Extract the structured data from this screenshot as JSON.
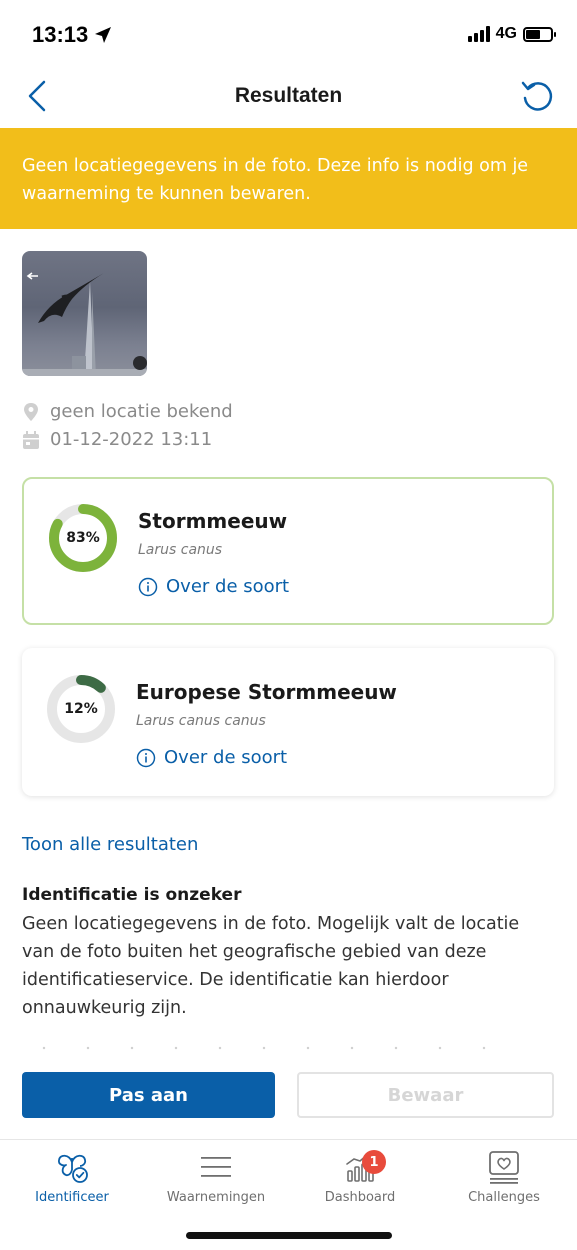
{
  "status": {
    "time": "13:13",
    "network": "4G"
  },
  "nav": {
    "title": "Resultaten"
  },
  "warning": {
    "text": "Geen locatiegegevens in de foto. Deze info is nodig om je waarneming te kunnen bewaren."
  },
  "meta": {
    "location": "geen locatie bekend",
    "date": "01-12-2022 13:11"
  },
  "results": [
    {
      "name": "Stormmeeuw",
      "scientific": "Larus canus",
      "percent_label": "83%",
      "percent": 83,
      "link": "Over de soort",
      "color": "#7db33b"
    },
    {
      "name": "Europese Stormmeeuw",
      "scientific": "Larus canus canus",
      "percent_label": "12%",
      "percent": 12,
      "link": "Over de soort",
      "color": "#3d6b45"
    }
  ],
  "show_all": "Toon alle resultaten",
  "uncertain": {
    "title": "Identificatie is onzeker",
    "text": "Geen locatiegegevens in de foto. Mogelijk valt de locatie van de foto buiten het geografische gebied van deze identificatieservice. De identificatie kan hierdoor onnauwkeurig zijn."
  },
  "buttons": {
    "adjust": "Pas aan",
    "save": "Bewaar"
  },
  "tabs": [
    {
      "label": "Identificeer",
      "icon": "identify-icon"
    },
    {
      "label": "Waarnemingen",
      "icon": "list-icon"
    },
    {
      "label": "Dashboard",
      "icon": "dashboard-icon",
      "badge": "1"
    },
    {
      "label": "Challenges",
      "icon": "challenges-icon"
    }
  ],
  "colors": {
    "accent": "#0a5fa8",
    "warning": "#f2be1a",
    "badge": "#e84b3c"
  }
}
